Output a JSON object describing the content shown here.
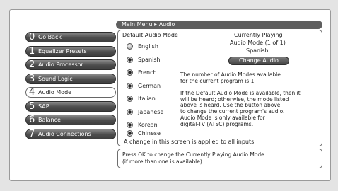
{
  "breadcrumb": "Main Menu ▸ Audio",
  "menu": [
    {
      "num": "0",
      "label": "Go Back",
      "selected": false
    },
    {
      "num": "1",
      "label": "Equalizer Presets",
      "selected": false
    },
    {
      "num": "2",
      "label": "Audio Processor",
      "selected": false
    },
    {
      "num": "3",
      "label": "Sound Logic",
      "selected": false
    },
    {
      "num": "4",
      "label": "Audio Mode",
      "selected": true
    },
    {
      "num": "5",
      "label": "SAP",
      "selected": false
    },
    {
      "num": "6",
      "label": "Balance",
      "selected": false
    },
    {
      "num": "7",
      "label": "Audio Connections",
      "selected": false
    }
  ],
  "default_mode": {
    "heading": "Default Audio Mode",
    "options": [
      {
        "label": "English",
        "selected": true
      },
      {
        "label": "Spanish",
        "selected": false
      },
      {
        "label": "French",
        "selected": false
      },
      {
        "label": "German",
        "selected": false
      },
      {
        "label": "Italian",
        "selected": false
      },
      {
        "label": "Japanese",
        "selected": false
      },
      {
        "label": "Korean",
        "selected": false
      },
      {
        "label": "Chinese",
        "selected": false
      }
    ]
  },
  "currently_playing": {
    "heading": "Currently Playing",
    "mode_line": "Audio Mode (1 of 1)",
    "language": "Spanish",
    "button": "Change Audio"
  },
  "info": {
    "count_text": "The number of Audio Modes available\nfor the current program is 1.",
    "default_text": "If the Default Audio Mode is available, then it\nwill be heard; otherwise, the mode listed\nabove is heard. Use the button above\nto change the current program's audio.",
    "digital_text": "Audio Mode is only available for\ndigital-TV (ATSC) programs."
  },
  "note": "A change in this screen is applied to all inputs.",
  "help": "Press OK to change the Currently Playing Audio Mode\n(if more than one is available)."
}
